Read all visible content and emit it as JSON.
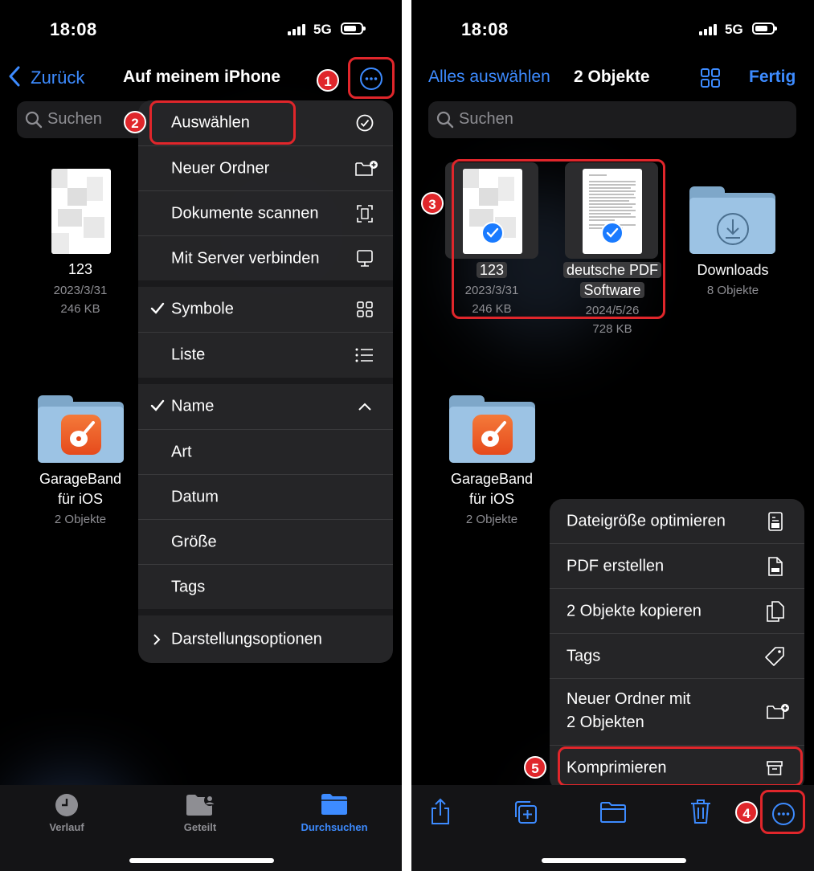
{
  "left": {
    "status": {
      "time": "18:08",
      "network": "5G"
    },
    "nav": {
      "back": "Zurück",
      "title": "Auf meinem iPhone"
    },
    "search": {
      "placeholder": "Suchen"
    },
    "files": [
      {
        "name": "123",
        "date": "2023/3/31",
        "size": "246 KB"
      },
      {
        "name_line1": "GarageBand",
        "name_line2": "für iOS",
        "meta": "2 Objekte"
      }
    ],
    "menu": {
      "items": [
        {
          "label": "Auswählen",
          "icon": "checkmark-circle-icon"
        },
        {
          "label": "Neuer Ordner",
          "icon": "folder-plus-icon"
        },
        {
          "label": "Dokumente scannen",
          "icon": "doc-scan-icon"
        },
        {
          "label": "Mit Server verbinden",
          "icon": "display-icon"
        },
        {
          "label": "Symbole",
          "icon": "grid-icon",
          "checked": true
        },
        {
          "label": "Liste",
          "icon": "list-icon"
        },
        {
          "label": "Name",
          "icon": "chevron-up-icon",
          "checked": true
        },
        {
          "label": "Art"
        },
        {
          "label": "Datum"
        },
        {
          "label": "Größe"
        },
        {
          "label": "Tags"
        },
        {
          "label": "Darstellungsoptionen",
          "icon": "chevron-right-icon"
        }
      ]
    },
    "tabs": [
      {
        "label": "Verlauf",
        "icon": "clock-icon"
      },
      {
        "label": "Geteilt",
        "icon": "shared-folder-icon"
      },
      {
        "label": "Durchsuchen",
        "icon": "folder-icon",
        "active": true
      }
    ],
    "badges": [
      "1",
      "2"
    ]
  },
  "right": {
    "status": {
      "time": "18:08",
      "network": "5G"
    },
    "nav": {
      "select_all": "Alles auswählen",
      "title": "2 Objekte",
      "done": "Fertig"
    },
    "search": {
      "placeholder": "Suchen"
    },
    "files": [
      {
        "name": "123",
        "date": "2023/3/31",
        "size": "246 KB",
        "selected": true
      },
      {
        "name_line1": "deutsche PDF",
        "name_line2": "Software",
        "date": "2024/5/26",
        "size": "728 KB",
        "selected": true
      },
      {
        "name": "Downloads",
        "meta": "8 Objekte"
      },
      {
        "name_line1": "GarageBand",
        "name_line2": "für iOS",
        "meta": "2 Objekte"
      }
    ],
    "menu": {
      "items": [
        {
          "label": "Dateigröße optimieren",
          "icon": "resize-doc-icon"
        },
        {
          "label": "PDF erstellen",
          "icon": "pdf-doc-icon"
        },
        {
          "label": "2 Objekte kopieren",
          "icon": "copy-docs-icon"
        },
        {
          "label": "Tags",
          "icon": "tag-icon"
        },
        {
          "label_line1": "Neuer Ordner mit",
          "label_line2": "2 Objekten",
          "icon": "folder-plus-icon"
        },
        {
          "label": "Komprimieren",
          "icon": "archive-box-icon"
        }
      ]
    },
    "toolbar": [
      "share-icon",
      "duplicate-icon",
      "move-folder-icon",
      "trash-icon",
      "more-icon"
    ],
    "badges": [
      "3",
      "4",
      "5"
    ]
  },
  "colors": {
    "accent": "#3d8bff",
    "annotation": "#e0262b",
    "garageband": "#f05a28"
  }
}
